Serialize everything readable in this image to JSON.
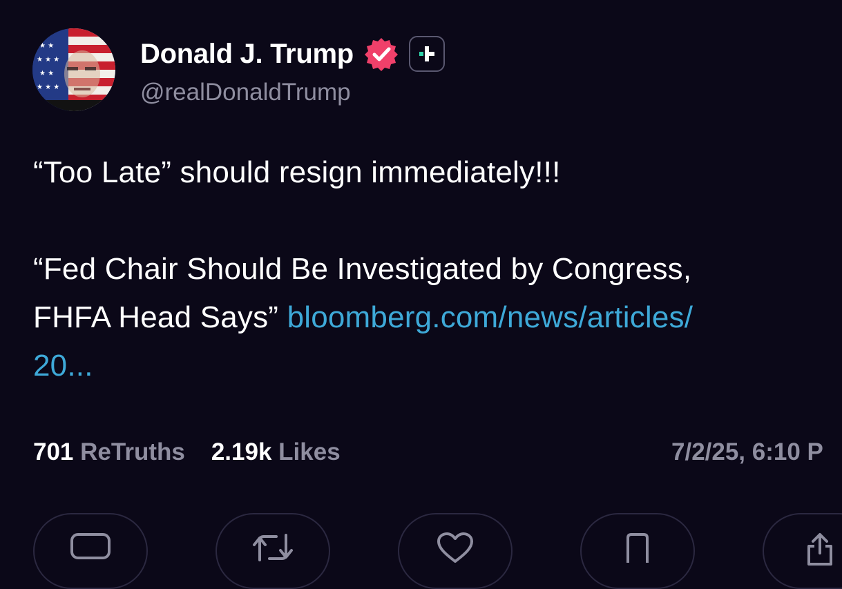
{
  "post": {
    "author": {
      "display_name": "Donald J. Trump",
      "handle": "@realDonaldTrump",
      "avatar_icon": "flag-portrait-avatar",
      "verified_icon": "verified-badge-icon",
      "plus_icon": "plus-badge-icon"
    },
    "body": {
      "line1": "“Too Late” should resign immediately!!!",
      "line2": "“Fed Chair Should Be Investigated by Congress,",
      "line3_text": "FHFA Head Says” ",
      "line3_link": "bloomberg.com/news/articles/",
      "line4_link": "20..."
    },
    "stats": {
      "retruths_count": "701",
      "retruths_label": "ReTruths",
      "likes_count": "2.19k",
      "likes_label": "Likes",
      "timestamp": "7/2/25, 6:10 P"
    },
    "actions": [
      {
        "name": "reply",
        "icon": "reply-icon"
      },
      {
        "name": "retruth",
        "icon": "retruth-icon"
      },
      {
        "name": "like",
        "icon": "heart-icon"
      },
      {
        "name": "bookmark",
        "icon": "bookmark-icon"
      },
      {
        "name": "share",
        "icon": "share-icon"
      }
    ],
    "colors": {
      "background": "#0b0818",
      "link": "#3ea9d8",
      "muted": "#8f8ea0",
      "verified": "#f0406a"
    }
  }
}
